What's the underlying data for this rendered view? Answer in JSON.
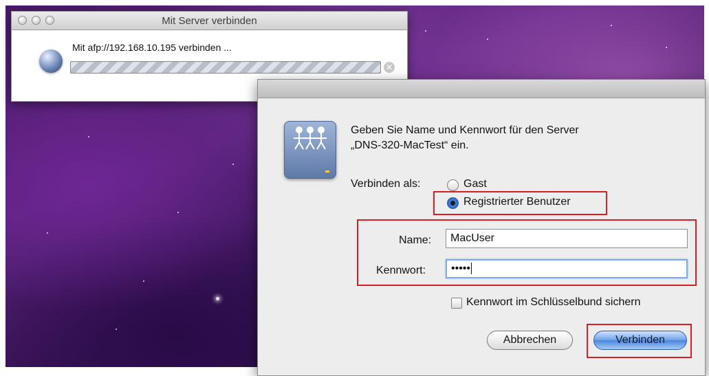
{
  "progress_window": {
    "title": "Mit Server verbinden",
    "status_text": "Mit afp://192.168.10.195 verbinden ...",
    "icon": "globe-icon"
  },
  "auth_dialog": {
    "prompt_line1": "Geben Sie Name und Kennwort für den Server",
    "prompt_line2": "„DNS-320-MacTest“ ein.",
    "icon": "server-share-icon",
    "connect_as_label": "Verbinden als:",
    "options": [
      {
        "label": "Gast",
        "selected": false
      },
      {
        "label": "Registrierter Benutzer",
        "selected": true
      }
    ],
    "name_label": "Name:",
    "name_value": "MacUser",
    "password_label": "Kennwort:",
    "password_value": "•••••",
    "keychain_label": "Kennwort im Schlüsselbund sichern",
    "keychain_checked": false,
    "cancel_label": "Abbrechen",
    "connect_label": "Verbinden"
  },
  "colors": {
    "highlight": "#d32027",
    "default_button": "#4a86dc",
    "focus_ring": "#7cacf0"
  }
}
